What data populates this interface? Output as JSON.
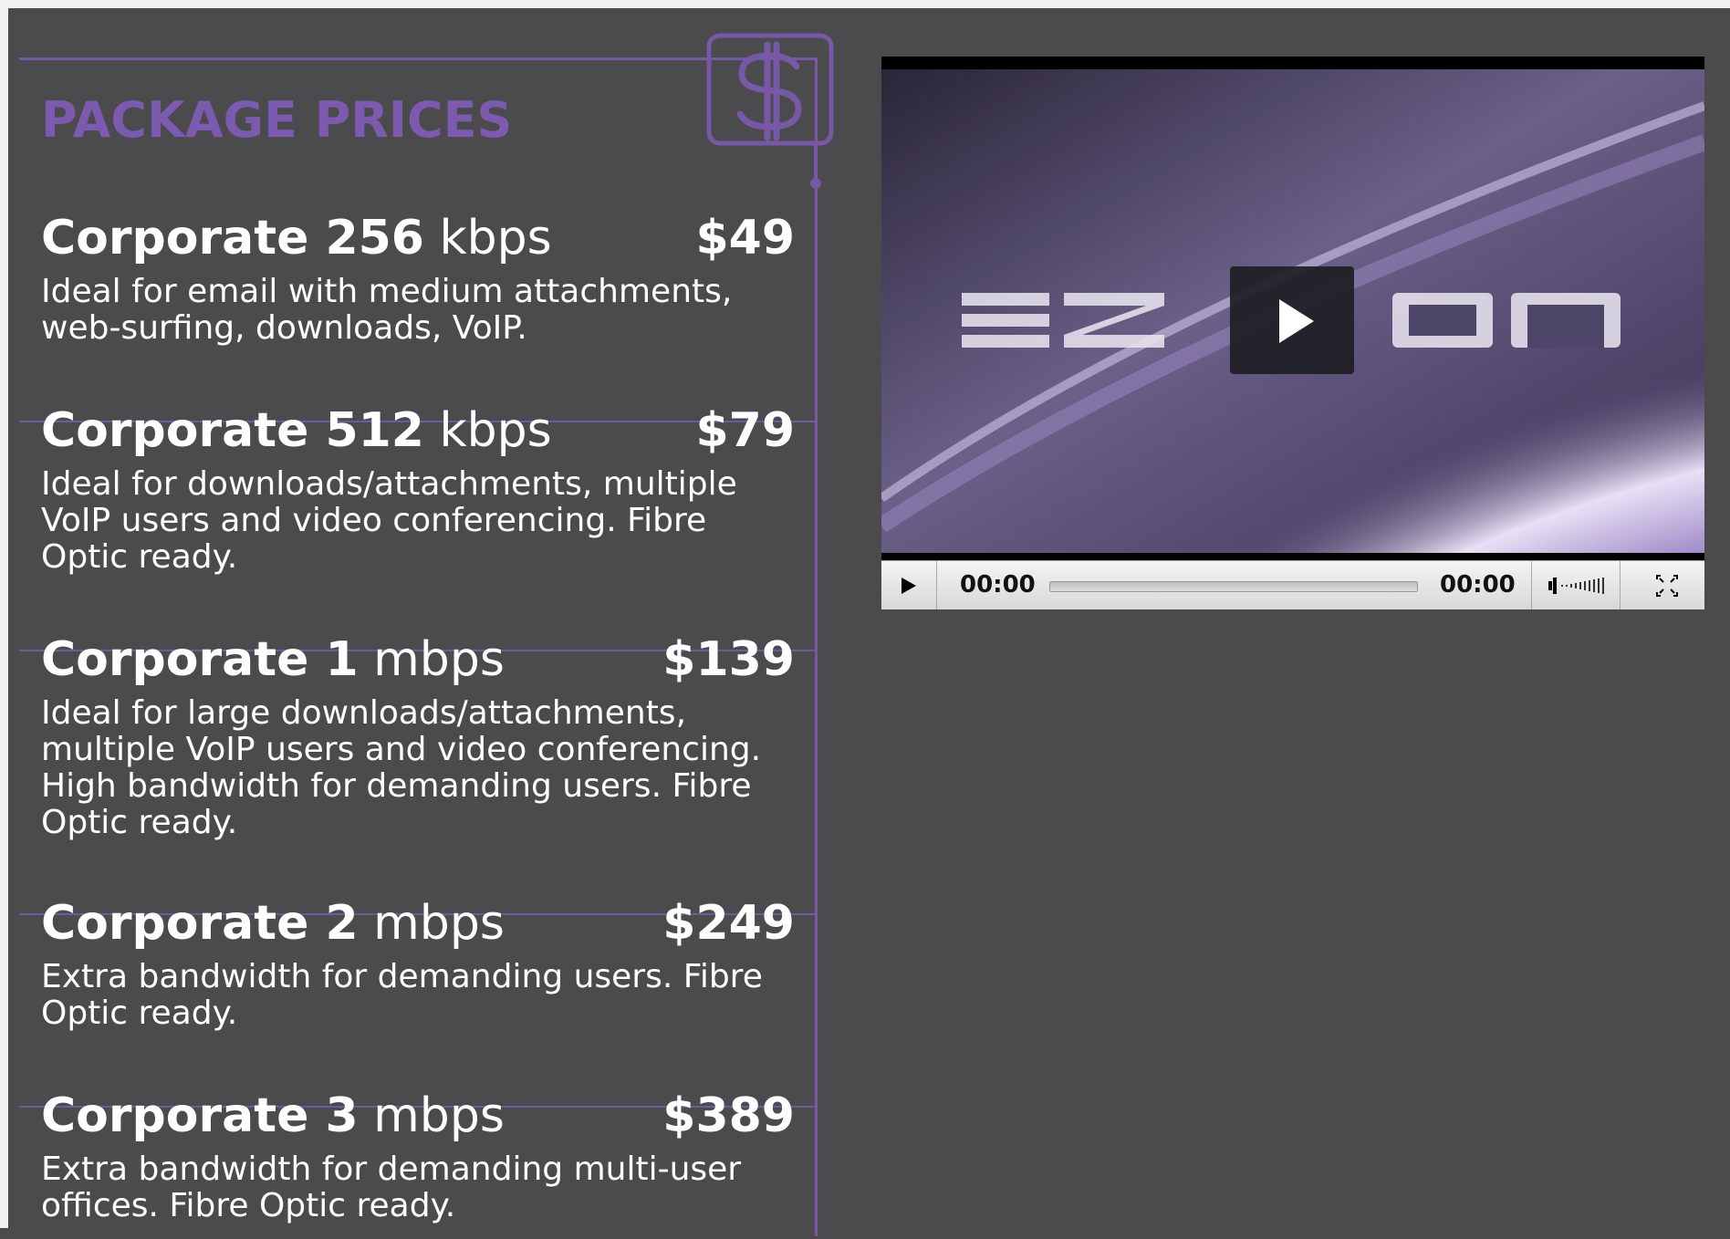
{
  "prices": {
    "title": "PACKAGE PRICES",
    "packages": [
      {
        "name": "Corporate 256",
        "unit": "kbps",
        "price": "$49",
        "description": "Ideal for email with medium attachments, web-surfing, downloads, VoIP."
      },
      {
        "name": "Corporate 512",
        "unit": "kbps",
        "price": "$79",
        "description": "Ideal for downloads/attachments, multiple VoIP users and video conferencing. Fibre Optic ready."
      },
      {
        "name": "Corporate 1",
        "unit": "mbps",
        "price": "$139",
        "description": "Ideal for large downloads/attachments, multiple VoIP users and video conferencing. High bandwidth for demanding users. Fibre Optic ready."
      },
      {
        "name": "Corporate 2",
        "unit": "mbps",
        "price": "$249",
        "description": "Extra bandwidth for demanding users. Fibre Optic ready."
      },
      {
        "name": "Corporate 3",
        "unit": "mbps",
        "price": "$389",
        "description": "Extra bandwidth for demanding multi-user offices. Fibre Optic ready."
      }
    ]
  },
  "player": {
    "poster_logo": "EZECOM",
    "current_time": "00:00",
    "total_time": "00:00",
    "progress_percent": 0,
    "icons": {
      "play": "play-icon",
      "volume": "volume-icon",
      "fullscreen": "fullscreen-icon",
      "badge": "dollar-icon"
    }
  },
  "colors": {
    "background": "#4b4a4c",
    "accent": "#7b5ab0",
    "text": "#ffffff"
  }
}
